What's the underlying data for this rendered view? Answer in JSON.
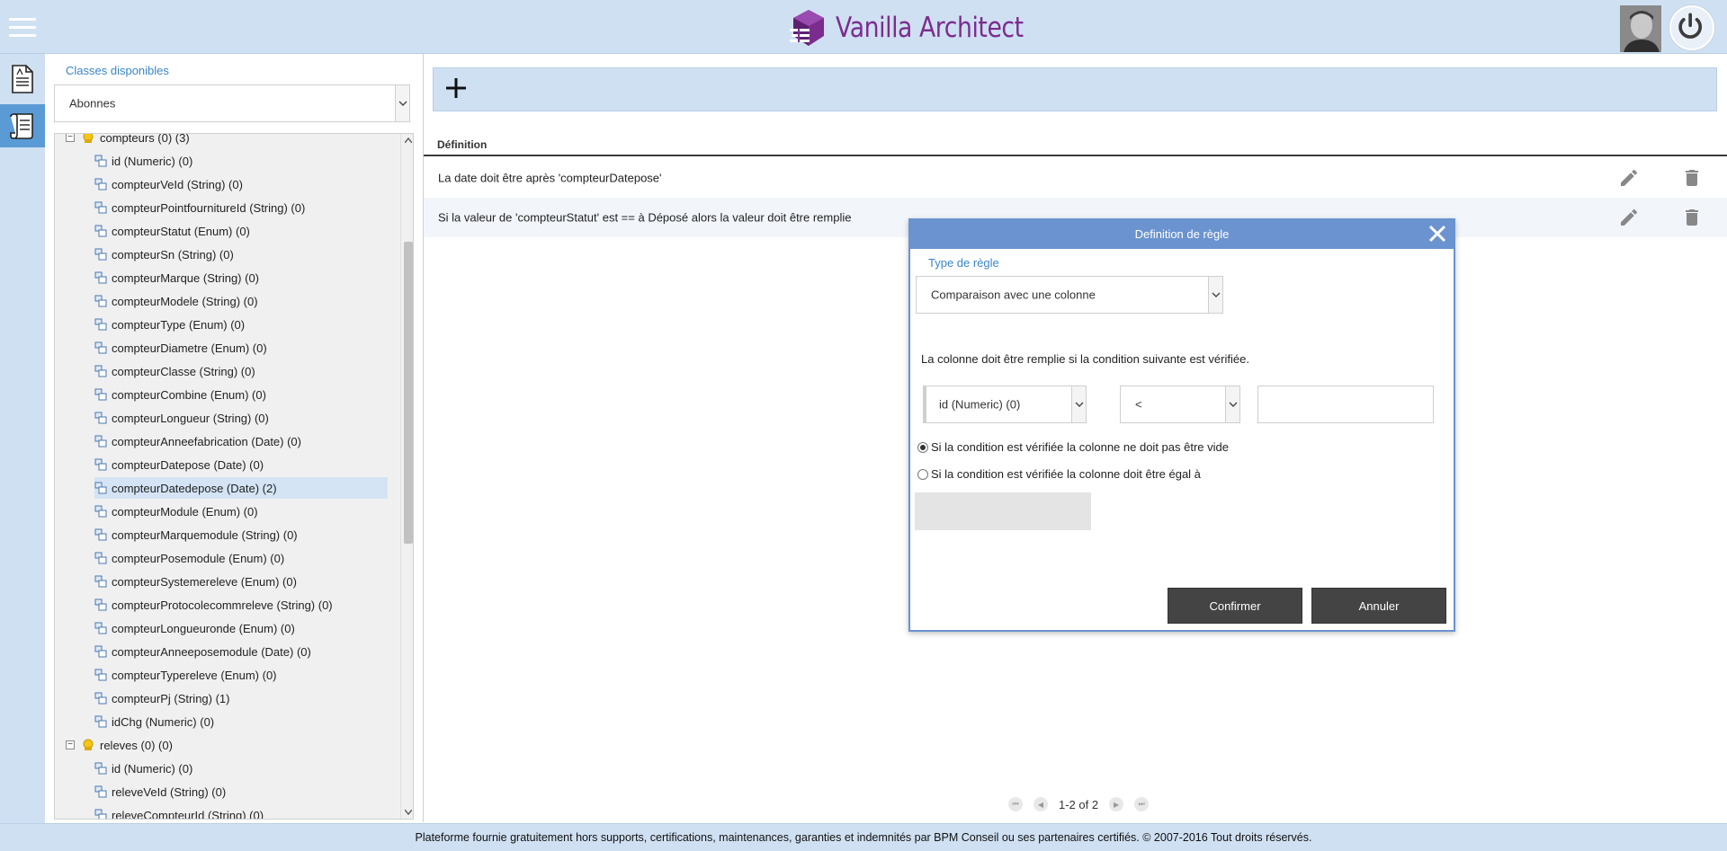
{
  "app": {
    "title": "Vanilla Architect"
  },
  "sidebar_nav": {
    "items": [
      {
        "icon": "document-icon",
        "active": false
      },
      {
        "icon": "script-icon",
        "active": true
      }
    ]
  },
  "classes": {
    "label": "Classes disponibles",
    "selected": "Abonnes",
    "tree": [
      {
        "kind": "class",
        "label": "compteurs (0) (3)",
        "expanded": true
      },
      {
        "kind": "leaf",
        "label": "id (Numeric) (0)"
      },
      {
        "kind": "leaf",
        "label": "compteurVeId (String) (0)"
      },
      {
        "kind": "leaf",
        "label": "compteurPointfournitureId (String) (0)"
      },
      {
        "kind": "leaf",
        "label": "compteurStatut (Enum) (0)"
      },
      {
        "kind": "leaf",
        "label": "compteurSn (String) (0)"
      },
      {
        "kind": "leaf",
        "label": "compteurMarque (String) (0)"
      },
      {
        "kind": "leaf",
        "label": "compteurModele (String) (0)"
      },
      {
        "kind": "leaf",
        "label": "compteurType (Enum) (0)"
      },
      {
        "kind": "leaf",
        "label": "compteurDiametre (Enum) (0)"
      },
      {
        "kind": "leaf",
        "label": "compteurClasse (String) (0)"
      },
      {
        "kind": "leaf",
        "label": "compteurCombine (Enum) (0)"
      },
      {
        "kind": "leaf",
        "label": "compteurLongueur (String) (0)"
      },
      {
        "kind": "leaf",
        "label": "compteurAnneefabrication (Date) (0)"
      },
      {
        "kind": "leaf",
        "label": "compteurDatepose (Date) (0)"
      },
      {
        "kind": "leaf",
        "label": "compteurDatedepose (Date) (2)",
        "selected": true
      },
      {
        "kind": "leaf",
        "label": "compteurModule (Enum) (0)"
      },
      {
        "kind": "leaf",
        "label": "compteurMarquemodule (String) (0)"
      },
      {
        "kind": "leaf",
        "label": "compteurPosemodule (Enum) (0)"
      },
      {
        "kind": "leaf",
        "label": "compteurSystemereleve (Enum) (0)"
      },
      {
        "kind": "leaf",
        "label": "compteurProtocolecommreleve (String) (0)"
      },
      {
        "kind": "leaf",
        "label": "compteurLongueuronde (Enum) (0)"
      },
      {
        "kind": "leaf",
        "label": "compteurAnneeposemodule (Date) (0)"
      },
      {
        "kind": "leaf",
        "label": "compteurTypereleve (Enum) (0)"
      },
      {
        "kind": "leaf",
        "label": "compteurPj (String) (1)"
      },
      {
        "kind": "leaf",
        "label": "idChg (Numeric) (0)"
      },
      {
        "kind": "class",
        "label": "releves (0) (0)",
        "expanded": true
      },
      {
        "kind": "leaf",
        "label": "id (Numeric) (0)"
      },
      {
        "kind": "leaf",
        "label": "releveVeId (String) (0)"
      },
      {
        "kind": "leaf",
        "label": "releveCompteurId (String) (0)"
      }
    ]
  },
  "rules": {
    "column_header": "Définition",
    "rows": [
      {
        "text": "La date doit être après 'compteurDatepose'"
      },
      {
        "text": "Si la valeur de 'compteurStatut' est == à Déposé alors la valeur doit être remplie"
      }
    ],
    "pager": {
      "info": "1-2 of 2"
    }
  },
  "modal": {
    "title": "Definition de règle",
    "rule_type_label": "Type de règle",
    "rule_type_value": "Comparaison avec une colonne",
    "condition_text": "La colonne doit être remplie si la condition suivante est vérifiée.",
    "column_select": "id (Numeric) (0)",
    "operator_select": "<",
    "value_input": "",
    "radio_not_empty": "Si la condition est vérifiée la colonne ne doit pas être vide",
    "radio_equal": "Si la condition est vérifiée la colonne doit être égal à",
    "confirm_label": "Confirmer",
    "cancel_label": "Annuler"
  },
  "footer": {
    "text": "Plateforme fournie gratuitement hors supports, certifications, maintenances, garanties et indemnités par BPM Conseil ou ses partenaires certifiés. © 2007-2016 Tout droits réservés."
  },
  "colors": {
    "header_bg": "#cfe0f2",
    "accent_blue": "#3a86c8",
    "modal_header": "#6a93d0",
    "brand_purple": "#7b2d8e",
    "button_dark": "#444444"
  }
}
